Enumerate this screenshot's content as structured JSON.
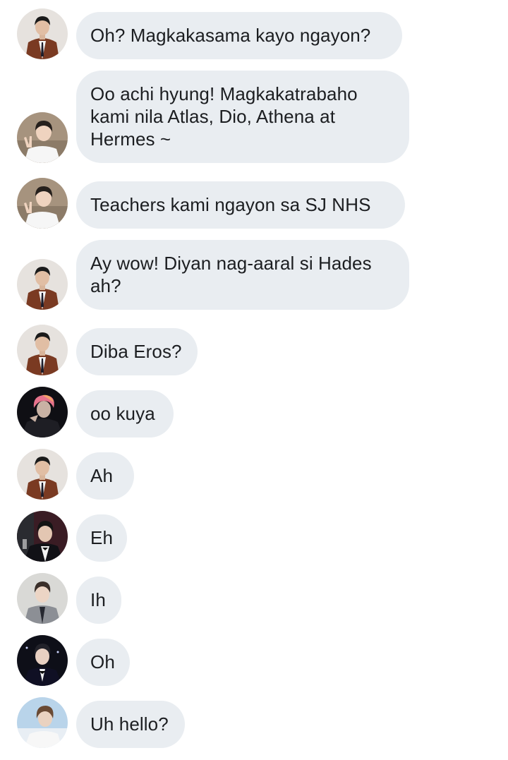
{
  "messages": [
    {
      "avatar": "man-brown-suit-avatar",
      "text": "Oh? Magkakasama kayo ngayon?"
    },
    {
      "avatar": "peace-sign-man-avatar",
      "text": "Oo achi hyung! Magkakatrabaho kami nila Atlas, Dio, Athena at Hermes ~"
    },
    {
      "avatar": "peace-sign-man-avatar",
      "text": "Teachers kami ngayon sa SJ NHS"
    },
    {
      "avatar": "man-brown-suit-avatar",
      "text": "Ay wow! Diyan nag-aaral si Hades ah?"
    },
    {
      "avatar": "man-brown-suit-avatar",
      "text": "Diba Eros?"
    },
    {
      "avatar": "pink-hair-man-avatar",
      "text": "oo kuya"
    },
    {
      "avatar": "man-brown-suit-avatar",
      "text": "Ah"
    },
    {
      "avatar": "tuxedo-man-avatar",
      "text": "Eh"
    },
    {
      "avatar": "gray-suit-man-avatar",
      "text": "Ih"
    },
    {
      "avatar": "black-tuxedo-man-avatar",
      "text": "Oh"
    },
    {
      "avatar": "sky-portrait-man-avatar",
      "text": "Uh hello?"
    }
  ],
  "colors": {
    "bubble": "#e9edf1",
    "text": "#1c1e21",
    "background": "#ffffff"
  }
}
